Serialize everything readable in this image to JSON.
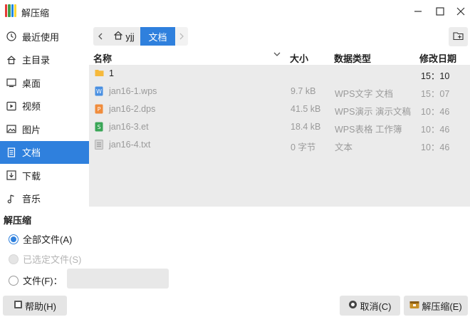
{
  "window": {
    "title": "解压缩",
    "controls": [
      "minimize-icon",
      "maximize-icon",
      "close-icon"
    ]
  },
  "sidebar": {
    "items": [
      {
        "label": "最近使用",
        "icon": "clock-icon"
      },
      {
        "label": "主目录",
        "icon": "home-icon"
      },
      {
        "label": "桌面",
        "icon": "desktop-icon"
      },
      {
        "label": "视频",
        "icon": "video-icon"
      },
      {
        "label": "图片",
        "icon": "picture-icon"
      },
      {
        "label": "文档",
        "icon": "document-icon",
        "active": true
      },
      {
        "label": "下载",
        "icon": "download-icon"
      },
      {
        "label": "音乐",
        "icon": "music-icon"
      }
    ]
  },
  "path": {
    "home_label": "yjj",
    "current_label": "文档"
  },
  "list": {
    "columns": [
      "名称",
      "大小",
      "数据类型",
      "修改日期"
    ],
    "rows": [
      {
        "name": "1",
        "size": "",
        "type": "",
        "date": "15：10",
        "icon": "folder-icon",
        "dim": false
      },
      {
        "name": "jan16-1.wps",
        "size": "9.7 kB",
        "type": "WPS文字 文档",
        "date": "15：07",
        "icon": "wps-writer-icon",
        "dim": true
      },
      {
        "name": "jan16-2.dps",
        "size": "41.5 kB",
        "type": "WPS演示 演示文稿",
        "date": "10：46",
        "icon": "wps-presentation-icon",
        "dim": true
      },
      {
        "name": "jan16-3.et",
        "size": "18.4 kB",
        "type": "WPS表格 工作簿",
        "date": "10：46",
        "icon": "wps-spreadsheet-icon",
        "dim": true
      },
      {
        "name": "jan16-4.txt",
        "size": "0 字节",
        "type": "文本",
        "date": "10：46",
        "icon": "text-file-icon",
        "dim": true
      }
    ]
  },
  "extract": {
    "section_label": "解压缩",
    "options": [
      {
        "label": "全部文件(A)",
        "checked": true,
        "disabled": false
      },
      {
        "label": "已选定文件(S)",
        "checked": false,
        "disabled": true
      },
      {
        "label": "文件(F)：",
        "checked": false,
        "disabled": false
      }
    ],
    "files_value": ""
  },
  "buttons": {
    "help": "帮助(H)",
    "cancel": "取消(C)",
    "extract": "解压缩(E)"
  },
  "colors": {
    "accent": "#2f80dd",
    "list_bg": "#ebebeb",
    "button_bg": "#e5e5e5"
  }
}
